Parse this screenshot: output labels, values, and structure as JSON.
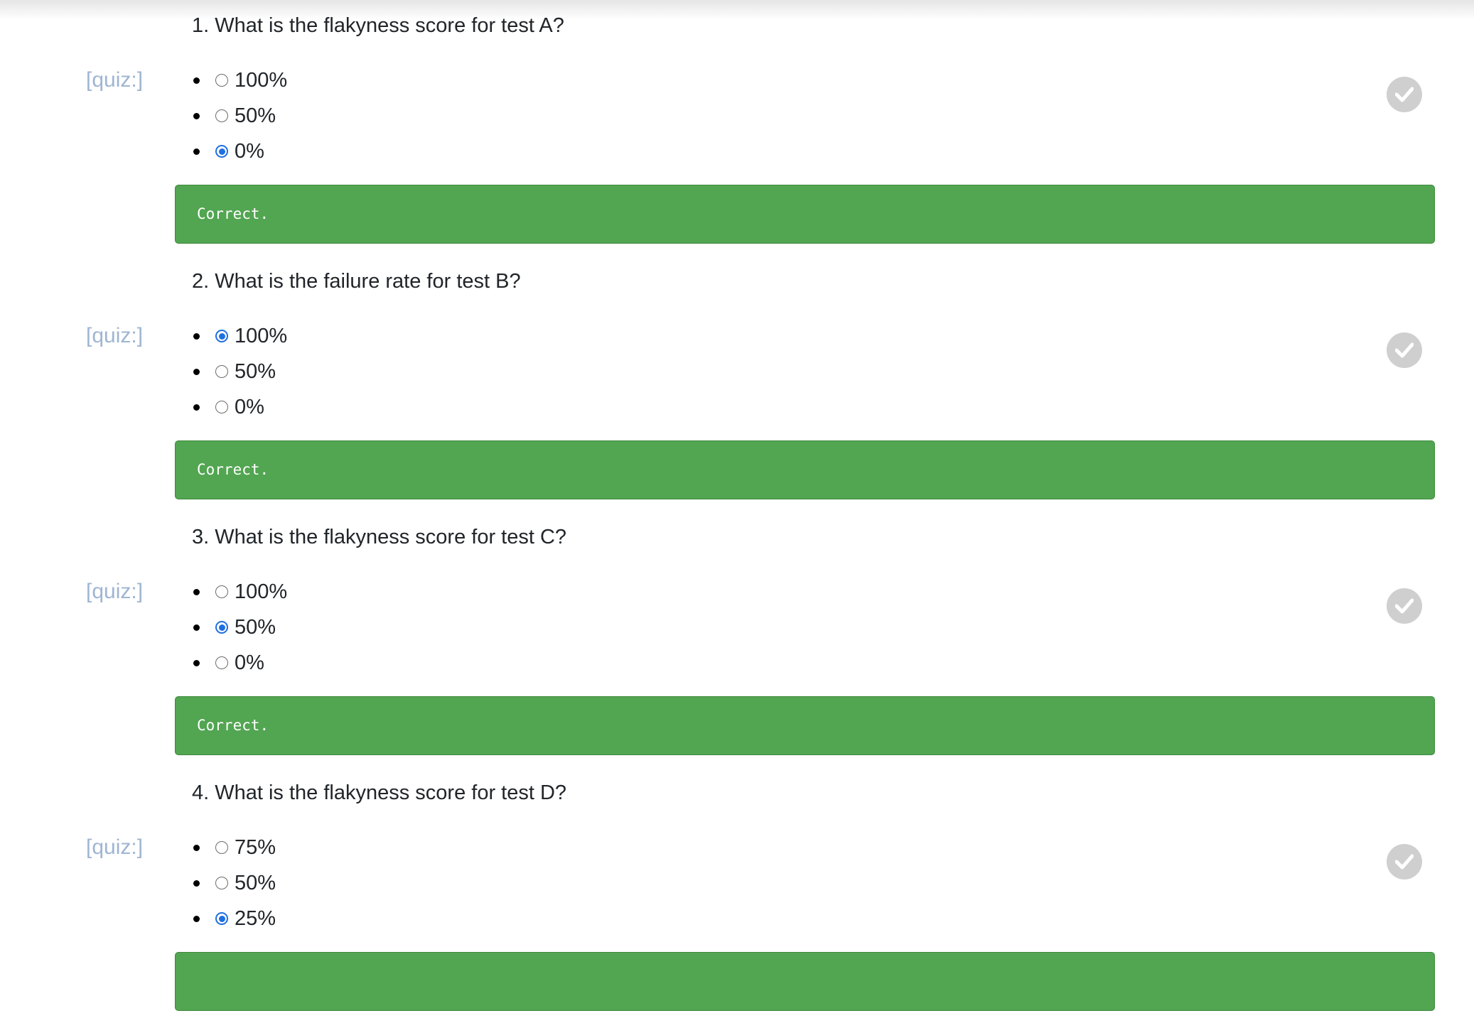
{
  "quiz_label": "[quiz:]",
  "feedback_text": "Correct.",
  "colors": {
    "feedback_bg": "#52a551",
    "quiz_label": "#9fb5d2",
    "radio_checked": "#1f6fe0",
    "check_button": "#cfcfcf"
  },
  "questions": [
    {
      "prompt": "1. What is the flakyness score for test A?",
      "options": [
        {
          "label": "100%",
          "selected": false
        },
        {
          "label": "50%",
          "selected": false
        },
        {
          "label": "0%",
          "selected": true
        }
      ],
      "feedback": "Correct.",
      "check_icon": "checkmark-icon"
    },
    {
      "prompt": "2. What is the failure rate for test B?",
      "options": [
        {
          "label": "100%",
          "selected": true
        },
        {
          "label": "50%",
          "selected": false
        },
        {
          "label": "0%",
          "selected": false
        }
      ],
      "feedback": "Correct.",
      "check_icon": "checkmark-icon"
    },
    {
      "prompt": "3. What is the flakyness score for test C?",
      "options": [
        {
          "label": "100%",
          "selected": false
        },
        {
          "label": "50%",
          "selected": true
        },
        {
          "label": "0%",
          "selected": false
        }
      ],
      "feedback": "Correct.",
      "check_icon": "checkmark-icon"
    },
    {
      "prompt": "4. What is the flakyness score for test D?",
      "options": [
        {
          "label": "75%",
          "selected": false
        },
        {
          "label": "50%",
          "selected": false
        },
        {
          "label": "25%",
          "selected": true
        }
      ],
      "feedback": "",
      "check_icon": "checkmark-icon"
    }
  ]
}
